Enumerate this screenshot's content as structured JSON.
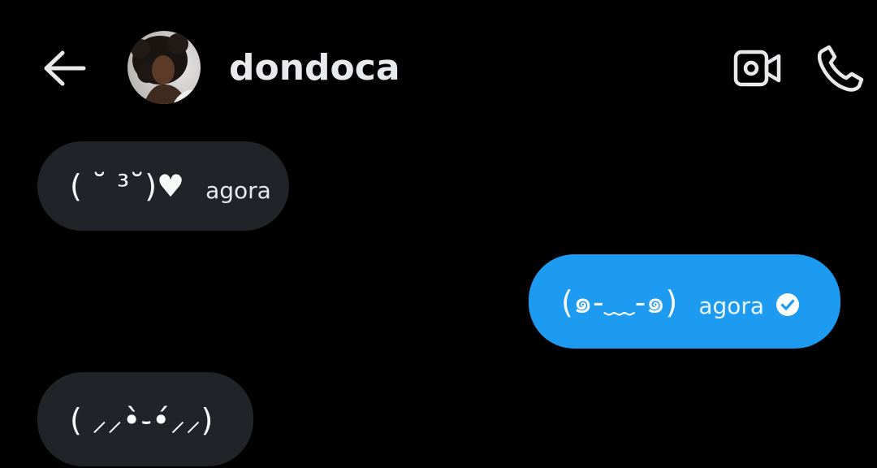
{
  "header": {
    "contact_name": "dondoca",
    "back_icon": "arrow-left-icon",
    "video_icon": "video-camera-icon",
    "call_icon": "phone-icon"
  },
  "colors": {
    "background": "#000000",
    "incoming_bubble": "#202327",
    "outgoing_bubble": "#1d9bf0",
    "text": "#e7e9ea"
  },
  "messages": [
    {
      "direction": "incoming",
      "text": "( ˘ ³˘)♥",
      "time": "agora"
    },
    {
      "direction": "outgoing",
      "text": "(๑-﹏-๑)",
      "time": "agora",
      "status_icon": "read-check-icon"
    },
    {
      "direction": "incoming",
      "text": "( ⸝⸝•̀֊•́⸝⸝)",
      "time": ""
    }
  ]
}
